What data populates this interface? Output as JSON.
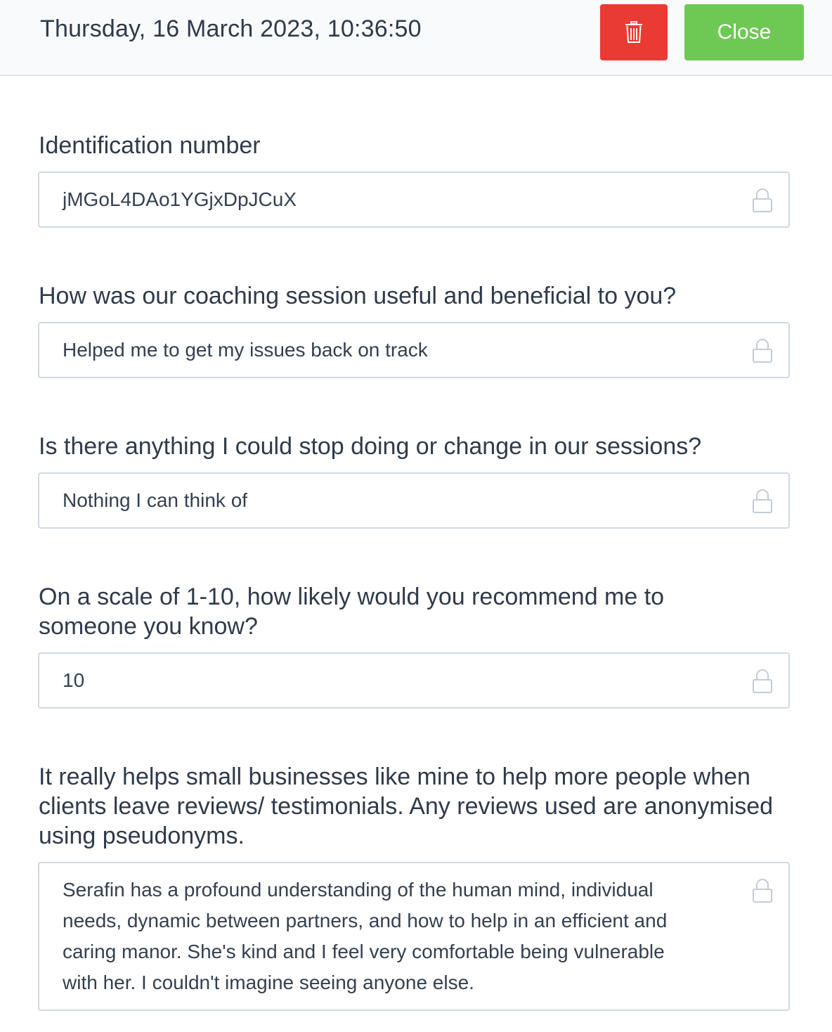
{
  "header": {
    "title": "Thursday, 16 March 2023, 10:36:50",
    "delete_icon": "trash-icon",
    "close_label": "Close"
  },
  "colors": {
    "delete": "#ea3a34",
    "close": "#6dc954",
    "text": "#2f3a4a",
    "border": "#cfd9e4"
  },
  "fields": [
    {
      "label": "Identification number",
      "value": "jMGoL4DAo1YGjxDpJCuX",
      "icon": "lock-icon"
    },
    {
      "label": "How was our coaching session useful and beneficial to you?",
      "value": "Helped me to get my issues back on track",
      "icon": "lock-icon"
    },
    {
      "label": "Is there anything I could stop doing or change in our sessions?",
      "value": "Nothing I can think of",
      "icon": "lock-icon"
    },
    {
      "label": "On a scale of 1-10, how likely would you recommend me to someone you know?",
      "value": "10",
      "icon": "lock-icon"
    },
    {
      "label": "It really helps small businesses like mine to help more people when clients leave reviews/ testimonials. Any reviews used are anonymised using pseudonyms.",
      "value": "Serafin has a profound understanding of the human mind, individual needs, dynamic between partners, and how to help in an efficient and caring manor. She's kind and I feel very comfortable being vulnerable with her. I couldn't imagine seeing anyone else.",
      "icon": "lock-icon"
    }
  ]
}
